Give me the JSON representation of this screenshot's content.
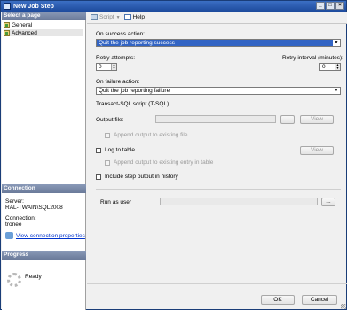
{
  "window": {
    "title": "New Job Step"
  },
  "left": {
    "select_page_header": "Select a page",
    "pages": [
      {
        "label": "General"
      },
      {
        "label": "Advanced"
      }
    ],
    "connection_header": "Connection",
    "server_label": "Server:",
    "server_value": "RAL-TWAIN\\SQL2008",
    "connection_label": "Connection:",
    "connection_value": "tronee",
    "view_connection_link": "View connection properties",
    "progress_header": "Progress",
    "progress_status": "Ready"
  },
  "toolbar": {
    "script_label": "Script",
    "help_label": "Help"
  },
  "form": {
    "on_success_label": "On success action:",
    "on_success_value": "Quit the job reporting success",
    "retry_attempts_label": "Retry attempts:",
    "retry_attempts_value": "0",
    "retry_interval_label": "Retry interval (minutes):",
    "retry_interval_value": "0",
    "on_failure_label": "On failure action:",
    "on_failure_value": "Quit the job reporting failure",
    "tsql_group_label": "Transact-SQL script (T-SQL)",
    "output_file_label": "Output file:",
    "browse_label": "...",
    "view_label": "View",
    "append_output_label": "Append output to existing file",
    "log_to_table_label": "Log to table",
    "append_entry_label": "Append output to existing entry in table",
    "include_history_label": "Include step output in history",
    "run_as_user_label": "Run as user",
    "run_as_browse_label": "..."
  },
  "buttons": {
    "ok_label": "OK",
    "cancel_label": "Cancel"
  }
}
